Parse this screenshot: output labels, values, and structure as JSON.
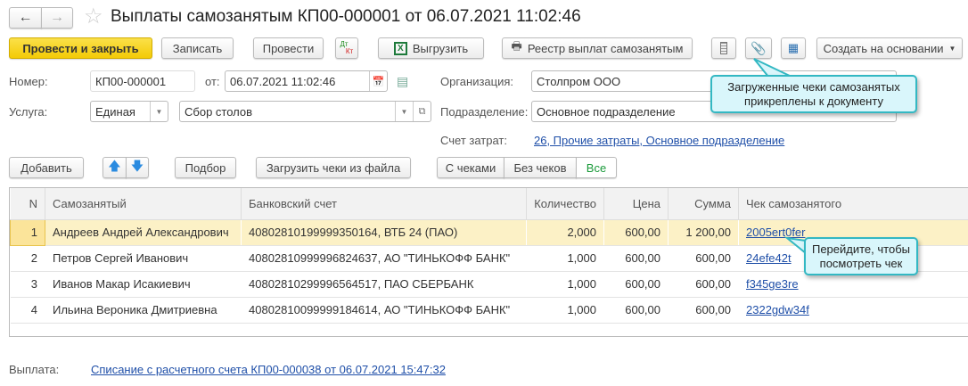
{
  "window": {
    "title": "Выплаты самозанятым КП00-000001 от 06.07.2021 11:02:46"
  },
  "toolbar": {
    "post_close": "Провести и закрыть",
    "save": "Записать",
    "post": "Провести",
    "dt": "Дт",
    "kt": "Кт",
    "export": "Выгрузить",
    "registry": "Реестр выплат самозанятым",
    "create_based": "Создать на основании"
  },
  "form": {
    "number_label": "Номер:",
    "number": "КП00-000001",
    "date_label": "от:",
    "date": "06.07.2021 11:02:46",
    "service_label": "Услуга:",
    "service_type": "Единая",
    "service": "Сбор столов",
    "org_label": "Организация:",
    "org": "Столпром ООО",
    "dept_label": "Подразделение:",
    "dept": "Основное подразделение",
    "cost_label": "Счет затрат:",
    "cost": "26, Прочие затраты, Основное подразделение"
  },
  "table_toolbar": {
    "add": "Добавить",
    "pick": "Подбор",
    "load": "Загрузить чеки из файла",
    "filters": [
      "С чеками",
      "Без чеков",
      "Все"
    ],
    "active_filter": "Все"
  },
  "table": {
    "columns": [
      "N",
      "Самозанятый",
      "Банковский счет",
      "Количество",
      "Цена",
      "Сумма",
      "Чек самозанятого"
    ],
    "rows": [
      {
        "n": "1",
        "name": "Андреев Андрей Александрович",
        "account": "40802810199999350164, ВТБ 24 (ПАО)",
        "qty": "2,000",
        "price": "600,00",
        "sum": "1 200,00",
        "receipt": "2005ert0fer"
      },
      {
        "n": "2",
        "name": "Петров Сергей Иванович",
        "account": "40802810999996824637, АО \"ТИНЬКОФФ БАНК\"",
        "qty": "1,000",
        "price": "600,00",
        "sum": "600,00",
        "receipt": "24efe42t"
      },
      {
        "n": "3",
        "name": "Иванов Макар Исакиевич",
        "account": "40802810299996564517, ПАО СБЕРБАНК",
        "qty": "1,000",
        "price": "600,00",
        "sum": "600,00",
        "receipt": "f345ge3re"
      },
      {
        "n": "4",
        "name": "Ильина Вероника Дмитриевна",
        "account": "40802810099999184614, АО \"ТИНЬКОФФ БАНК\"",
        "qty": "1,000",
        "price": "600,00",
        "sum": "600,00",
        "receipt": "2322gdw34f"
      }
    ]
  },
  "footer": {
    "payment_label": "Выплата:",
    "payment": "Списание с расчетного счета КП00-000038 от 06.07.2021 15:47:32"
  },
  "tooltips": {
    "attach": "Загруженные чеки самозанятых прикреплены к документу",
    "receipt": "Перейдите, чтобы посмотреть чек"
  }
}
